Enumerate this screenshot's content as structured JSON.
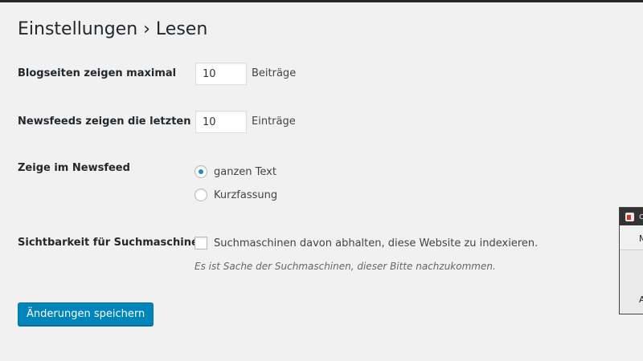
{
  "header": {
    "title": "Einstellungen › Lesen"
  },
  "settings": {
    "blog_pages": {
      "label": "Blogseiten zeigen maximal",
      "value": "10",
      "suffix": "Beiträge"
    },
    "feed_items": {
      "label": "Newsfeeds zeigen die letzten",
      "value": "10",
      "suffix": "Einträge"
    },
    "feed_content": {
      "label": "Zeige im Newsfeed",
      "options": [
        {
          "label": "ganzen Text",
          "checked": true
        },
        {
          "label": "Kurzfassung",
          "checked": false
        }
      ]
    },
    "search_visibility": {
      "label": "Sichtbarkeit für Suchmaschinen",
      "checkbox_label": "Suchmaschinen davon abhalten, diese Website zu indexieren.",
      "checked": false,
      "hint": "Es ist Sache der Suchmaschinen, dieser Bitte nachzukommen."
    }
  },
  "actions": {
    "save_label": "Änderungen speichern"
  },
  "external_window": {
    "title_char": "c",
    "char_top": "M",
    "char_bottom": "A"
  },
  "colors": {
    "accent": "#0085ba",
    "radio_dot": "#1e8cbe",
    "background": "#f1f1f1"
  }
}
